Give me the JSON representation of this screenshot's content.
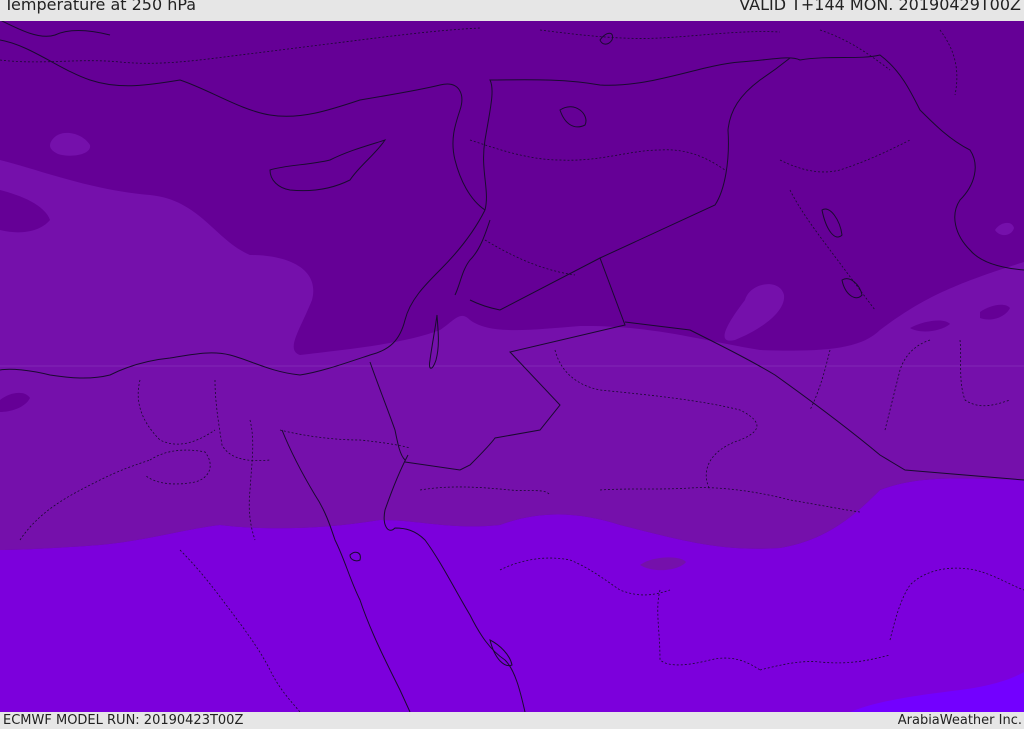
{
  "header": {
    "title": "Temperature at 250 hPa",
    "valid": "VALID T+144 MON. 20190429T00Z"
  },
  "footer": {
    "model_run": "ECMWF MODEL RUN: 20190423T00Z",
    "credit": "ArabiaWeather Inc."
  },
  "map": {
    "colors": {
      "coldest_band": "#650096",
      "cold_band": "#7510ab",
      "mid_band": "#7c00dc",
      "warm_band": "#7300ff",
      "borders": "#1a0a30"
    }
  }
}
